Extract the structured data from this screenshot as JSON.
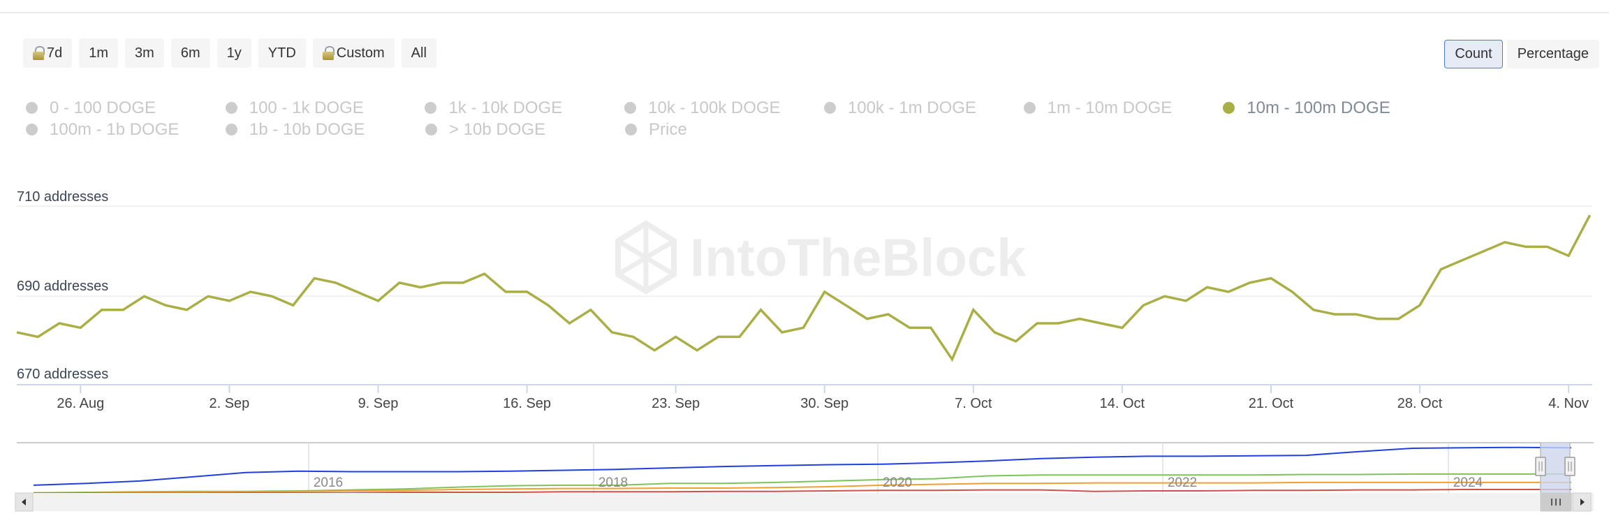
{
  "toolbar": {
    "ranges": [
      {
        "label": "7d",
        "locked": true
      },
      {
        "label": "1m",
        "locked": false
      },
      {
        "label": "3m",
        "locked": false
      },
      {
        "label": "6m",
        "locked": false
      },
      {
        "label": "1y",
        "locked": false
      },
      {
        "label": "YTD",
        "locked": false
      },
      {
        "label": "Custom",
        "locked": true
      },
      {
        "label": "All",
        "locked": false
      }
    ],
    "modes": [
      {
        "label": "Count",
        "active": true
      },
      {
        "label": "Percentage",
        "active": false
      }
    ]
  },
  "legend": {
    "rows": [
      [
        {
          "label": "0 - 100 DOGE",
          "active": false
        },
        {
          "label": "100 - 1k DOGE",
          "active": false
        },
        {
          "label": "1k - 10k DOGE",
          "active": false
        },
        {
          "label": "10k - 100k DOGE",
          "active": false
        },
        {
          "label": "100k - 1m DOGE",
          "active": false
        },
        {
          "label": "1m - 10m DOGE",
          "active": false
        },
        {
          "label": "10m - 100m DOGE",
          "active": true
        }
      ],
      [
        {
          "label": "100m - 1b DOGE",
          "active": false
        },
        {
          "label": "1b - 10b DOGE",
          "active": false
        },
        {
          "label": "> 10b DOGE",
          "active": false
        },
        {
          "label": "Price",
          "active": false
        }
      ]
    ],
    "active_color": "#a9af44",
    "inactive_color": "#cccccc"
  },
  "watermark": "IntoTheBlock",
  "chart_data": {
    "type": "line",
    "title": "",
    "xlabel": "",
    "ylabel": "",
    "series": [
      {
        "name": "10m - 100m DOGE",
        "color": "#a9af44",
        "start_date": "23 Aug",
        "end_date": "5 Nov",
        "interval": "1 day",
        "values": [
          682,
          681,
          684,
          683,
          687,
          687,
          690,
          688,
          687,
          690,
          689,
          691,
          690,
          688,
          694,
          693,
          691,
          689,
          693,
          692,
          693,
          693,
          695,
          691,
          691,
          688,
          684,
          687,
          682,
          681,
          678,
          681,
          678,
          681,
          681,
          687,
          682,
          683,
          691,
          688,
          685,
          686,
          683,
          683,
          676,
          687,
          682,
          680,
          684,
          684,
          685,
          684,
          683,
          688,
          690,
          689,
          692,
          691,
          693,
          694,
          691,
          687,
          686,
          686,
          685,
          685,
          688,
          696,
          698,
          700,
          702,
          701,
          701,
          699,
          708
        ]
      }
    ],
    "yticks": [
      {
        "value": 670,
        "label": "670 addresses"
      },
      {
        "value": 690,
        "label": "690 addresses"
      },
      {
        "value": 710,
        "label": "710 addresses"
      }
    ],
    "ylim": [
      669.5,
      712.5
    ],
    "xticks": [
      {
        "index": 3,
        "label": "26. Aug"
      },
      {
        "index": 10,
        "label": "2. Sep"
      },
      {
        "index": 17,
        "label": "9. Sep"
      },
      {
        "index": 24,
        "label": "16. Sep"
      },
      {
        "index": 31,
        "label": "23. Sep"
      },
      {
        "index": 38,
        "label": "30. Sep"
      },
      {
        "index": 45,
        "label": "7. Oct"
      },
      {
        "index": 52,
        "label": "14. Oct"
      },
      {
        "index": 59,
        "label": "21. Oct"
      },
      {
        "index": 66,
        "label": "28. Oct"
      },
      {
        "index": 73,
        "label": "4. Nov"
      }
    ],
    "grid": true,
    "legend_position": "top-left",
    "navigator": {
      "year_labels": [
        "2016",
        "2018",
        "2020",
        "2022",
        "2024"
      ],
      "series": [
        {
          "name": "count-total",
          "color": "#1f3fe0",
          "values": [
            0.18,
            0.22,
            0.27,
            0.36,
            0.45,
            0.48,
            0.47,
            0.47,
            0.47,
            0.48,
            0.5,
            0.52,
            0.55,
            0.58,
            0.6,
            0.62,
            0.63,
            0.66,
            0.7,
            0.75,
            0.78,
            0.8,
            0.8,
            0.81,
            0.82,
            0.9,
            0.97,
            0.98,
            0.99,
            0.98
          ]
        },
        {
          "name": "band-green",
          "color": "#7dc35a",
          "values": [
            0.02,
            0.03,
            0.04,
            0.05,
            0.05,
            0.06,
            0.08,
            0.1,
            0.14,
            0.17,
            0.18,
            0.18,
            0.22,
            0.22,
            0.24,
            0.27,
            0.3,
            0.32,
            0.38,
            0.4,
            0.4,
            0.4,
            0.4,
            0.4,
            0.41,
            0.41,
            0.42,
            0.42,
            0.42,
            0.42
          ]
        },
        {
          "name": "band-orange",
          "color": "#f0a030",
          "values": [
            0.02,
            0.02,
            0.03,
            0.03,
            0.04,
            0.05,
            0.06,
            0.07,
            0.09,
            0.1,
            0.11,
            0.11,
            0.12,
            0.12,
            0.13,
            0.15,
            0.18,
            0.2,
            0.22,
            0.22,
            0.23,
            0.23,
            0.23,
            0.23,
            0.24,
            0.24,
            0.24,
            0.24,
            0.24,
            0.24
          ]
        },
        {
          "name": "band-red",
          "color": "#d0504a",
          "values": [
            0.01,
            0.01,
            0.01,
            0.01,
            0.02,
            0.02,
            0.02,
            0.03,
            0.03,
            0.03,
            0.04,
            0.04,
            0.04,
            0.05,
            0.05,
            0.06,
            0.07,
            0.07,
            0.08,
            0.08,
            0.05,
            0.06,
            0.06,
            0.07,
            0.07,
            0.08,
            0.08,
            0.09,
            0.09,
            0.09
          ]
        }
      ],
      "selected_range": "23 Aug - 5 Nov"
    }
  }
}
